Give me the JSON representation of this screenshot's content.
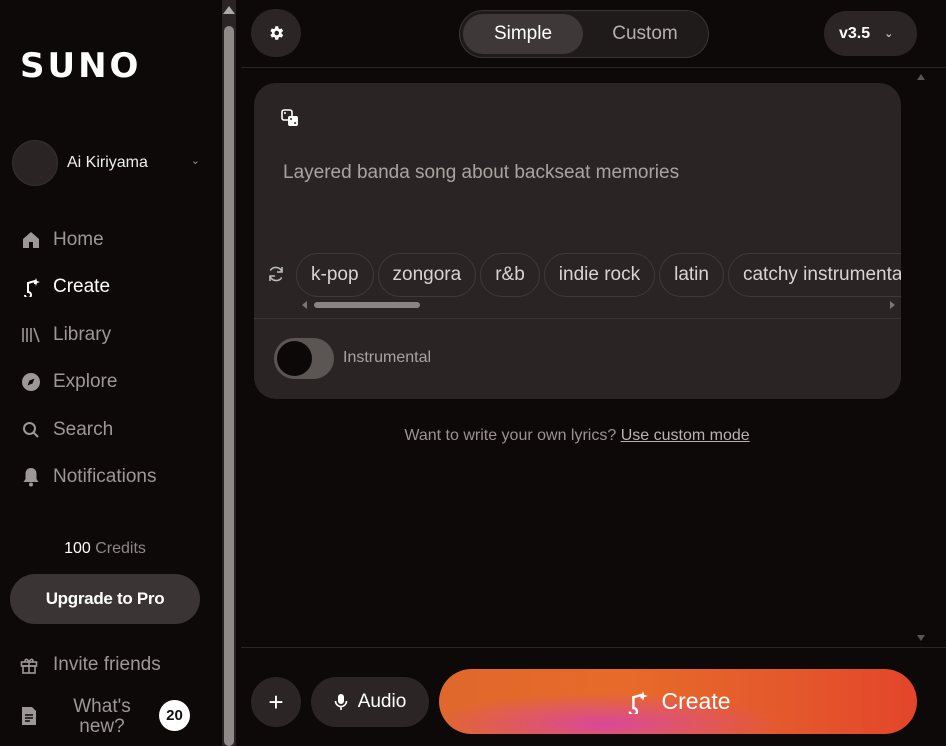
{
  "sidebar": {
    "logo": "SUNO",
    "user": {
      "name": "Ai Kiriyama"
    },
    "nav": [
      {
        "label": "Home",
        "icon": "home-icon"
      },
      {
        "label": "Create",
        "icon": "create-icon",
        "active": true
      },
      {
        "label": "Library",
        "icon": "library-icon"
      },
      {
        "label": "Explore",
        "icon": "compass-icon"
      },
      {
        "label": "Search",
        "icon": "search-icon"
      },
      {
        "label": "Notifications",
        "icon": "bell-icon"
      }
    ],
    "credits_value": "100",
    "credits_label": "Credits",
    "upgrade_label": "Upgrade to Pro",
    "invite_label": "Invite friends",
    "whats_new_line1": "What's",
    "whats_new_line2": "new?",
    "whats_new_badge": "20"
  },
  "header": {
    "mode_simple": "Simple",
    "mode_custom": "Custom",
    "version": "v3.5"
  },
  "card": {
    "prompt": "Layered banda song about backseat memories",
    "tags": [
      "k-pop",
      "zongora",
      "r&b",
      "indie rock",
      "latin",
      "catchy instrumental"
    ],
    "instrumental_label": "Instrumental"
  },
  "hint": {
    "text": "Want to write your own lyrics?",
    "link": "Use custom mode"
  },
  "footer": {
    "audio_label": "Audio",
    "create_label": "Create"
  },
  "colors": {
    "background": "#0d0908",
    "panel": "#2a2524",
    "create_gradient_start": "#e0682c",
    "create_gradient_end": "#e3452a"
  }
}
